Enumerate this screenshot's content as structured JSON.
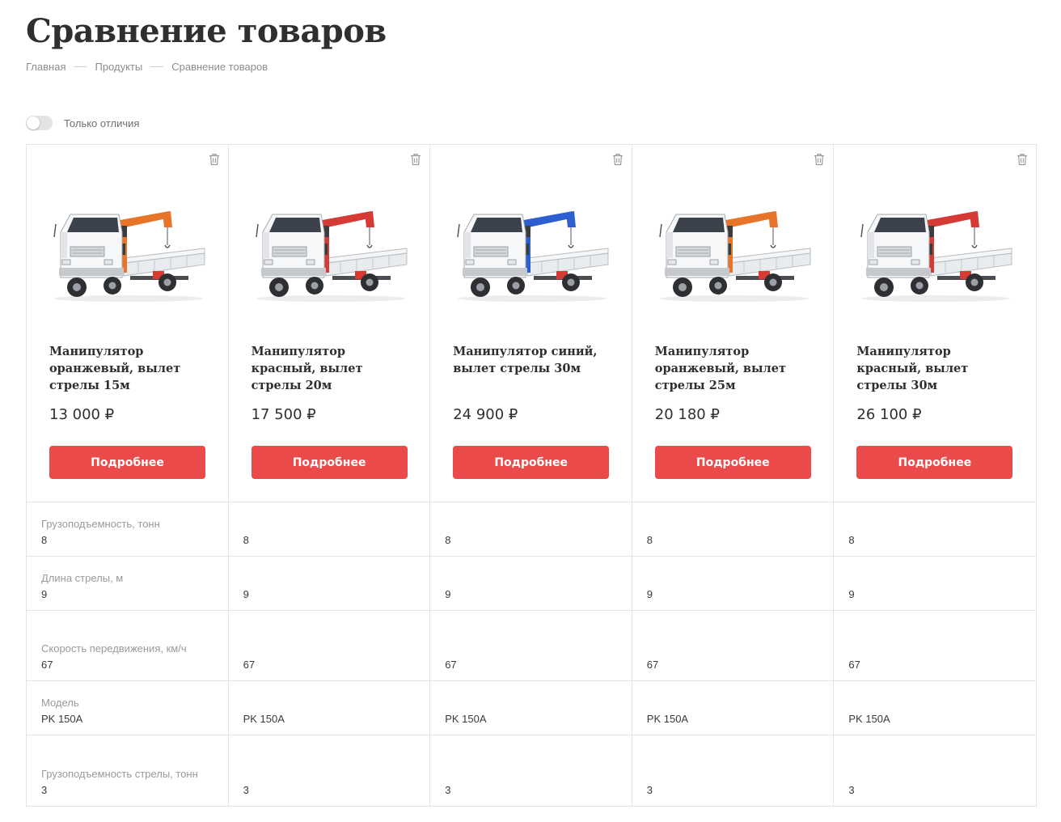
{
  "page": {
    "title": "Сравнение товаров"
  },
  "breadcrumb": [
    "Главная",
    "Продукты",
    "Сравнение товаров"
  ],
  "filter": {
    "only_differences_label": "Только отличия",
    "only_differences_on": false
  },
  "colors": {
    "accent": "#ea4a49",
    "crane_orange": "#e8742a",
    "crane_red": "#d63a35",
    "crane_blue": "#2e5fd1"
  },
  "products": [
    {
      "name": "Манипулятор оранжевый, вылет стрелы 15м",
      "price": "13 000 ₽",
      "button": "Подробнее",
      "crane_color": "crane_orange",
      "delete_icon": "trash-icon"
    },
    {
      "name": "Манипулятор красный, вылет стрелы 20м",
      "price": "17 500 ₽",
      "button": "Подробнее",
      "crane_color": "crane_red",
      "delete_icon": "trash-icon"
    },
    {
      "name": "Манипулятор синий, вылет стрелы 30м",
      "price": "24 900 ₽",
      "button": "Подробнее",
      "crane_color": "crane_blue",
      "delete_icon": "trash-icon"
    },
    {
      "name": "Манипулятор оранжевый, вылет стрелы 25м",
      "price": "20 180 ₽",
      "button": "Подробнее",
      "crane_color": "crane_orange",
      "delete_icon": "trash-icon"
    },
    {
      "name": "Манипулятор красный, вылет стрелы 30м",
      "price": "26 100 ₽",
      "button": "Подробнее",
      "crane_color": "crane_red",
      "delete_icon": "trash-icon"
    }
  ],
  "specs": [
    {
      "label": "Грузоподъемность, тонн",
      "values": [
        "8",
        "8",
        "8",
        "8",
        "8"
      ]
    },
    {
      "label": "Длина стрелы, м",
      "values": [
        "9",
        "9",
        "9",
        "9",
        "9"
      ]
    },
    {
      "label": "Скорость передвижения, км/ч",
      "values": [
        "67",
        "67",
        "67",
        "67",
        "67"
      ]
    },
    {
      "label": "Модель",
      "values": [
        "PK 150A",
        "PK 150A",
        "PK 150A",
        "PK 150A",
        "PK 150A"
      ]
    },
    {
      "label": "Грузоподъемность стрелы, тонн",
      "values": [
        "3",
        "3",
        "3",
        "3",
        "3"
      ]
    }
  ]
}
